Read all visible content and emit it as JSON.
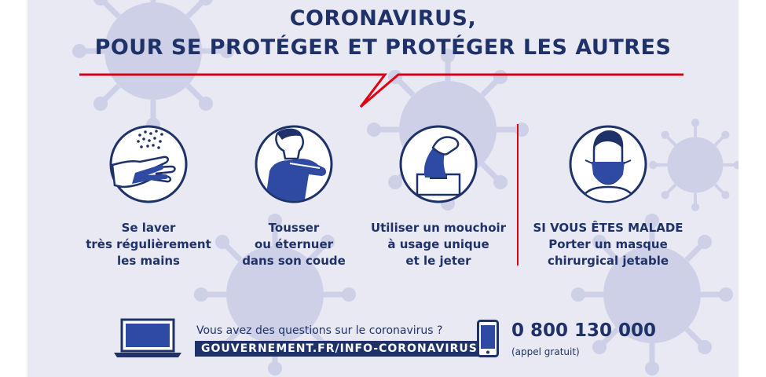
{
  "title": {
    "line1": "CORONAVIRUS,",
    "line2": "POUR SE PROTÉGER ET PROTÉGER LES AUTRES"
  },
  "colors": {
    "navy": "#1e3269",
    "red": "#e1000f",
    "background": "#e9e9f4",
    "virus": "#cdd0e6"
  },
  "actions": [
    {
      "icon": "hand-washing-icon",
      "line1": "Se laver",
      "line2": "très régulièrement",
      "line3": "les mains"
    },
    {
      "icon": "cough-in-elbow-icon",
      "line1": "Tousser",
      "line2": "ou éternuer",
      "line3": "dans son coude"
    },
    {
      "icon": "tissue-box-icon",
      "line1": "Utiliser un mouchoir",
      "line2": "à usage unique",
      "line3": "et le jeter"
    },
    {
      "icon": "surgical-mask-icon",
      "line1": "SI VOUS ÊTES MALADE",
      "line2": "Porter un masque",
      "line3": "chirurgical jetable"
    }
  ],
  "footer": {
    "question": "Vous avez des questions sur le coronavirus ?",
    "url": "GOUVERNEMENT.FR/INFO-CORONAVIRUS",
    "phone_number": "0 800 130 000",
    "phone_note": "(appel gratuit)",
    "laptop_icon": "laptop-icon",
    "phone_icon": "smartphone-icon"
  }
}
